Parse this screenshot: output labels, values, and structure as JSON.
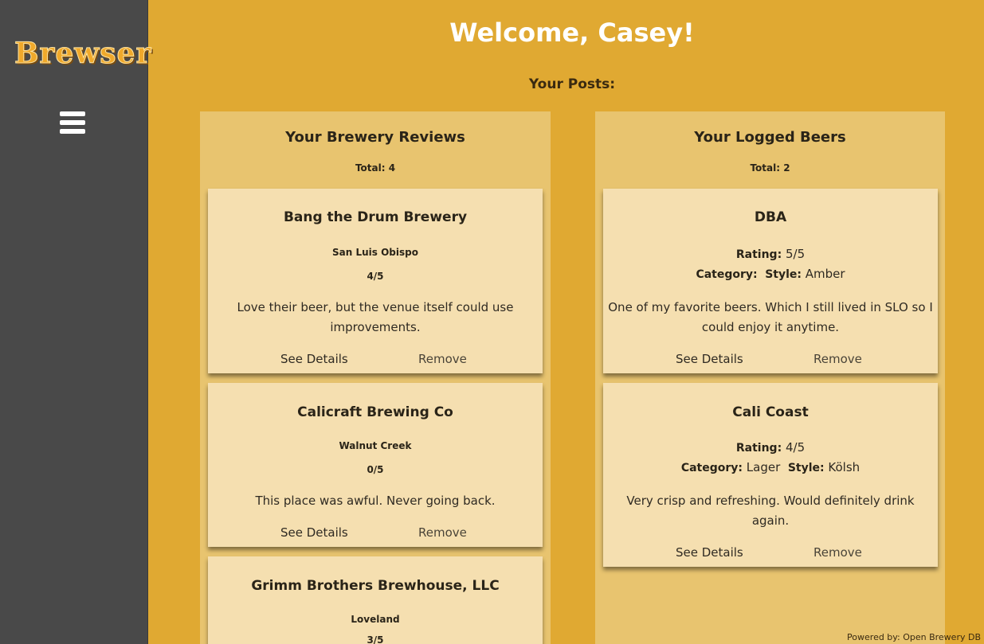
{
  "app": {
    "logo": "Brewser"
  },
  "header": {
    "welcome": "Welcome, Casey!",
    "subtitle": "Your Posts:"
  },
  "reviews": {
    "title": "Your Brewery Reviews",
    "total": "Total: 4",
    "items": [
      {
        "name": "Bang the Drum Brewery",
        "location": "San Luis Obispo",
        "rating": "4/5",
        "text": "Love their beer, but the venue itself could use improvements."
      },
      {
        "name": "Calicraft Brewing Co",
        "location": "Walnut Creek",
        "rating": "0/5",
        "text": "This place was awful. Never going back."
      },
      {
        "name": "Grimm Brothers Brewhouse, LLC",
        "location": "Loveland",
        "rating": "3/5",
        "text": ""
      }
    ]
  },
  "beers": {
    "title": "Your Logged Beers",
    "total": "Total: 2",
    "items": [
      {
        "name": "DBA",
        "rating_label": "Rating:",
        "rating": "5/5",
        "category_label": "Category:",
        "category": "",
        "style_label": "Style:",
        "style": "Amber",
        "text": "One of my favorite beers. Which I still lived in SLO so I could enjoy it anytime."
      },
      {
        "name": "Cali Coast",
        "rating_label": "Rating:",
        "rating": "4/5",
        "category_label": "Category:",
        "category": "Lager",
        "style_label": "Style:",
        "style": "Kölsh",
        "text": "Very crisp and refreshing. Would definitely drink again."
      }
    ]
  },
  "actions": {
    "details": "See Details",
    "remove": "Remove"
  },
  "footer": {
    "powered": "Powered by: Open Brewery DB"
  },
  "icons": {
    "menu": "hamburger-menu-icon"
  },
  "colors": {
    "background": "#e0a932",
    "sidebar": "#494949",
    "panel": "#e8c46f",
    "card": "#f5dfb0",
    "logo": "#f0a92b"
  }
}
